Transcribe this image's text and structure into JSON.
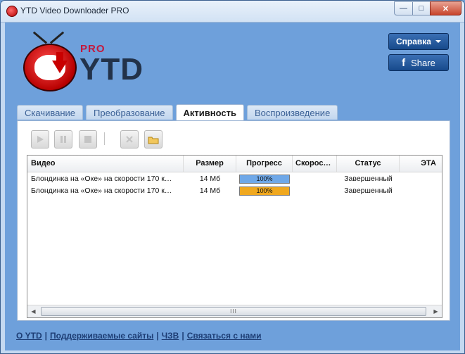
{
  "window": {
    "title": "YTD Video Downloader PRO"
  },
  "logo": {
    "pro": "PRO",
    "ytd": "YTD"
  },
  "header": {
    "help_label": "Справка",
    "share_label": "Share"
  },
  "tabs": [
    {
      "label": "Скачивание",
      "active": false
    },
    {
      "label": "Преобразование",
      "active": false
    },
    {
      "label": "Активность",
      "active": true
    },
    {
      "label": "Воспроизведение",
      "active": false
    }
  ],
  "toolbar": {
    "icons": [
      "play-icon",
      "pause-icon",
      "stop-icon",
      "delete-icon",
      "folder-icon"
    ]
  },
  "table": {
    "columns": [
      "Видео",
      "Размер",
      "Прогресс",
      "Скорос…",
      "Статус",
      "ЭТА"
    ],
    "rows": [
      {
        "video": "Блондинка на «Оке» на скорости 170 к…",
        "size": "14 Мб",
        "progress": "100%",
        "progress_value": 100,
        "progress_color": "#6fa8e8",
        "speed": "",
        "status": "Завершенный",
        "eta": ""
      },
      {
        "video": "Блондинка на «Оке» на скорости 170 к…",
        "size": "14 Мб",
        "progress": "100%",
        "progress_value": 100,
        "progress_color": "#f0a81e",
        "speed": "",
        "status": "Завершенный",
        "eta": ""
      }
    ]
  },
  "scrollbar": {
    "grip": "III"
  },
  "footer": {
    "links": [
      "О YTD",
      "Поддерживаемые сайты",
      "ЧЗВ",
      "Связаться с нами"
    ],
    "separator": "|"
  },
  "colors": {
    "accent": "#6ea0db",
    "header_button": "#174a8b",
    "link": "#1d3d74"
  }
}
